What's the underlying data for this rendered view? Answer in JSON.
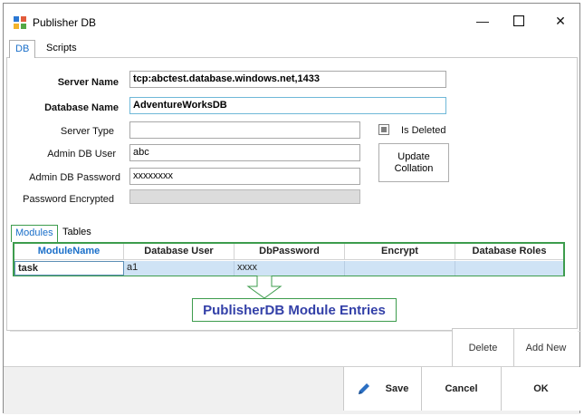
{
  "window": {
    "title": "Publisher DB",
    "minimize_glyph": "—",
    "maximize_glyph": "☐",
    "close_glyph": "✕"
  },
  "tabs": [
    {
      "label": "DB",
      "active": true
    },
    {
      "label": "Scripts",
      "active": false
    }
  ],
  "form": {
    "server_name_label": "Server Name",
    "server_name_value": "tcp:abctest.database.windows.net,1433",
    "database_name_label": "Database Name",
    "database_name_value": "AdventureWorksDB",
    "server_type_label": "Server Type",
    "server_type_value": "",
    "admin_user_label": "Admin DB User",
    "admin_user_value": "abc",
    "admin_password_label": "Admin DB Password",
    "admin_password_value": "xxxxxxxx",
    "password_encrypted_label": "Password Encrypted",
    "password_encrypted_value": "",
    "is_deleted_label": "Is Deleted",
    "is_deleted_checked": true,
    "update_collation_label_line1": "Update",
    "update_collation_label_line2": "Collation"
  },
  "subtabs": [
    {
      "label": "Modules",
      "active": true
    },
    {
      "label": "Tables",
      "active": false
    }
  ],
  "grid": {
    "columns": [
      "ModuleName",
      "Database User",
      "DbPassword",
      "Encrypt",
      "Database Roles"
    ],
    "rows": [
      [
        "task",
        "a1",
        "xxxx",
        "",
        ""
      ]
    ]
  },
  "callout": {
    "text": "PublisherDB Module Entries"
  },
  "actions": {
    "delete_label": "Delete",
    "add_new_label": "Add New"
  },
  "footer": {
    "save_label": "Save",
    "cancel_label": "Cancel",
    "ok_label": "OK"
  },
  "colors": {
    "accent_blue": "#1a6fc9",
    "highlight_green": "#3d9c4d",
    "callout_text": "#3340a8",
    "row_selection": "#cfe3f5"
  }
}
